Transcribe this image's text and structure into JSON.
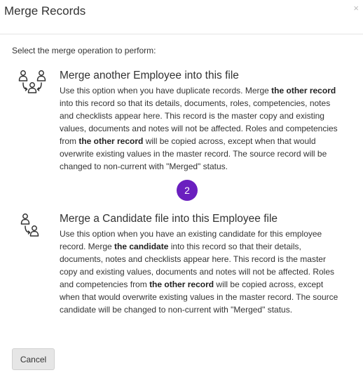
{
  "dialog": {
    "title": "Merge Records",
    "close_glyph": "×",
    "instruction": "Select the merge operation to perform:"
  },
  "options": [
    {
      "icon": "merge-employees-icon",
      "title": "Merge another Employee into this file",
      "desc": {
        "p1": "Use this option when you have duplicate records. Merge ",
        "b1": "the other record",
        "p2": " into this record so that its details, documents, roles, competencies, notes and checklists appear here. This record is the master copy and existing values, documents and notes will not be affected. Roles and competencies from ",
        "b2": "the other record",
        "p3": " will be copied across, except when that would overwrite existing values in the master record. The source record will be changed to non-current with \"Merged\" status."
      }
    },
    {
      "icon": "merge-candidate-icon",
      "title": "Merge a Candidate file into this Employee file",
      "desc": {
        "p1": "Use this option when you have an existing candidate for this employee record. Merge ",
        "b1": "the candidate",
        "p2": " into this record so that their details, documents, notes and checklists appear here. This record is the master copy and existing values, documents and notes will not be affected. Roles and competencies from ",
        "b2": "the other record",
        "p3": " will be copied across, except when that would overwrite existing values in the master record. The source candidate will be changed to non-current with \"Merged\" status."
      }
    }
  ],
  "step_badge": "2",
  "badge_color": "#6a1fbf",
  "footer": {
    "cancel_label": "Cancel"
  }
}
